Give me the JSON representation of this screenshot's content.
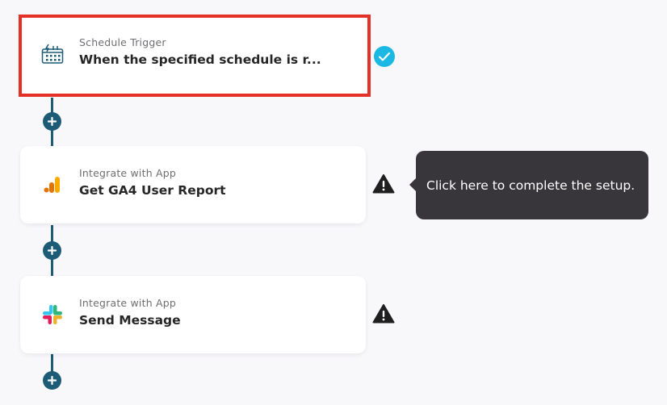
{
  "flow": {
    "steps": [
      {
        "subtitle": "Schedule Trigger",
        "title": "When the specified schedule is r...",
        "icon": "calendar-clock-icon",
        "status": "completed"
      },
      {
        "subtitle": "Integrate with App",
        "title": "Get GA4 User Report",
        "icon": "google-analytics-icon",
        "status": "warning"
      },
      {
        "subtitle": "Integrate with App",
        "title": "Send Message",
        "icon": "slack-icon",
        "status": "warning"
      }
    ],
    "add_button_label": "+"
  },
  "tooltip": {
    "text": "Click here to complete the setup."
  },
  "colors": {
    "connector": "#1d5b76",
    "highlight_border": "#e53027",
    "check_badge": "#1ab8e2",
    "tooltip_bg": "#38363a",
    "ga_orange": "#f9ab00",
    "ga_dark_orange": "#e37400"
  }
}
